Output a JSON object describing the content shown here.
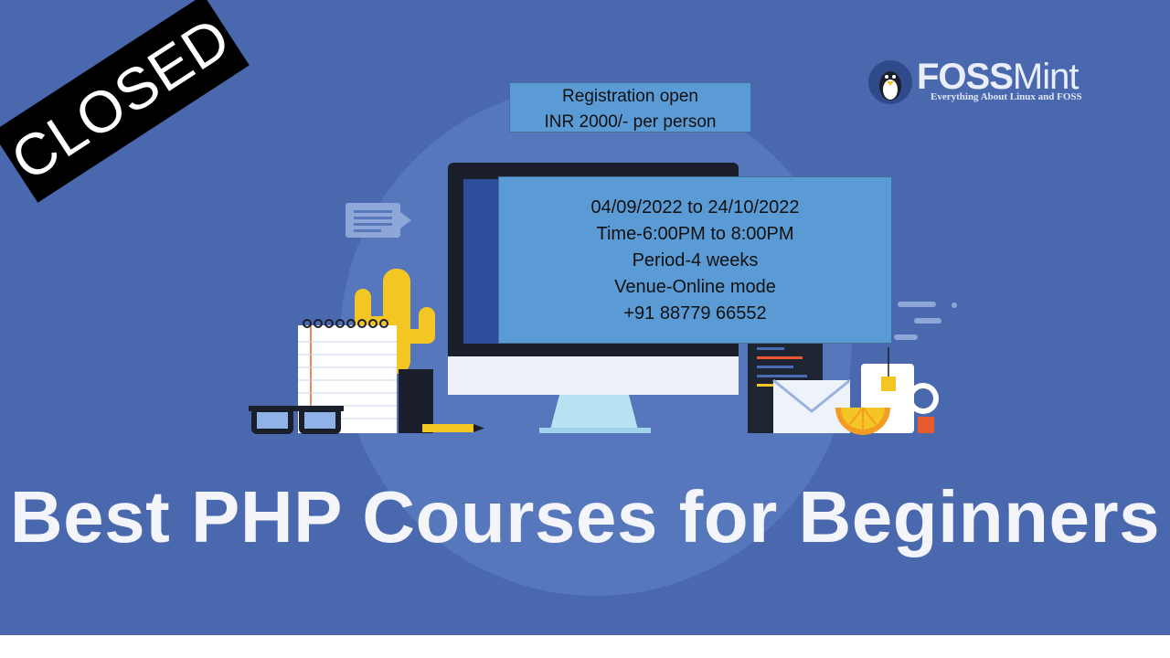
{
  "stamp": {
    "label": "CLOSED"
  },
  "registration": {
    "line1": "Registration open",
    "line2": "INR 2000/- per person"
  },
  "details": {
    "dates": "04/09/2022 to 24/10/2022",
    "time": "Time-6:00PM to 8:00PM",
    "period": "Period-4 weeks",
    "venue": "Venue-Online mode",
    "phone": "+91 88779 66552"
  },
  "logo": {
    "name_bold": "FOSS",
    "name_thin": "Mint",
    "tagline": "Everything About Linux and FOSS"
  },
  "headline": "Best PHP Courses for Beginners",
  "colors": {
    "background": "#4a68ae",
    "info_box": "#5b9bd5",
    "stamp": "#000000",
    "headline": "#f3f5fb"
  },
  "icons": [
    "penguin-logo-icon",
    "monitor-illustration",
    "notepad-illustration",
    "cactus-illustration",
    "glasses-illustration",
    "pencil-illustration",
    "envelope-illustration",
    "mug-illustration",
    "chat-bubble-icon",
    "code-panel-illustration"
  ]
}
